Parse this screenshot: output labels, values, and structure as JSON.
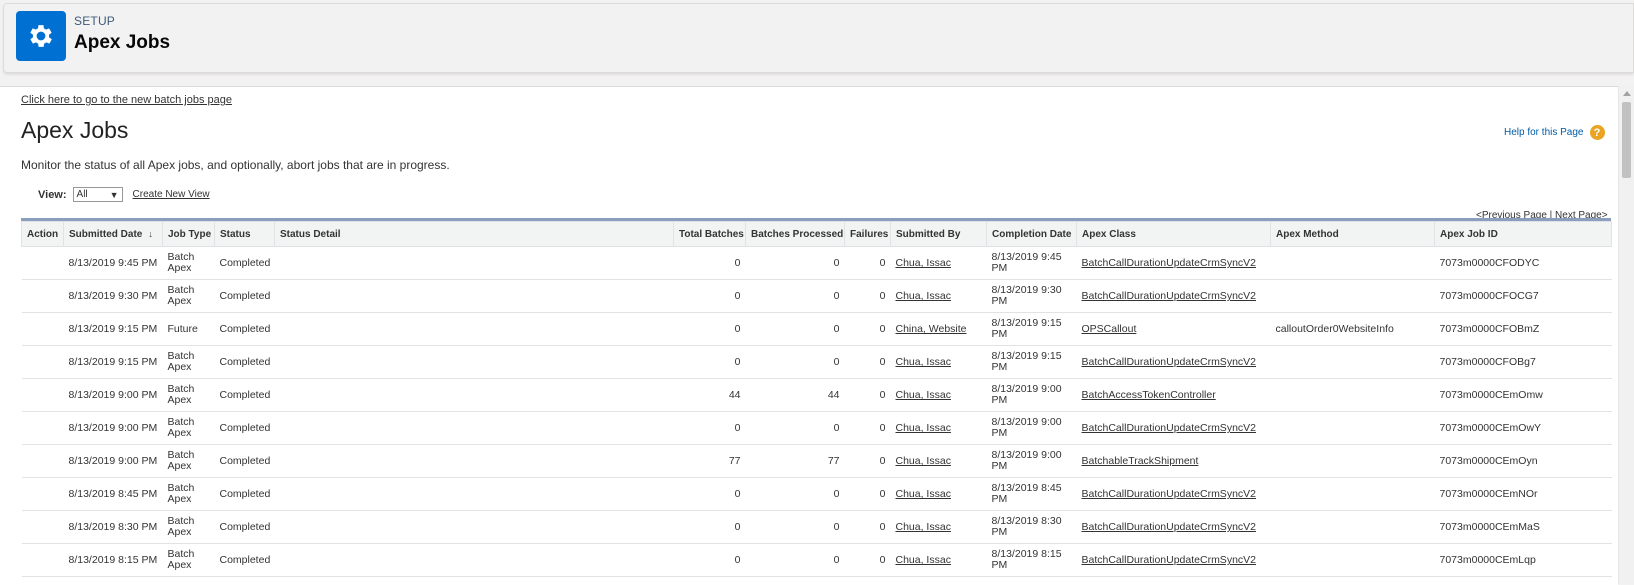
{
  "header": {
    "eyebrow": "SETUP",
    "title": "Apex Jobs",
    "icon": "gear-icon",
    "icon_color": "#0070d2"
  },
  "top_link": "Click here to go to the new batch jobs page",
  "page_title": "Apex Jobs",
  "help": {
    "label": "Help for this Page",
    "icon": "?"
  },
  "description": "Monitor the status of all Apex jobs, and optionally, abort jobs that are in progress.",
  "view": {
    "label": "View:",
    "selected": "All",
    "create_link": "Create New View"
  },
  "pager": {
    "prev": "<Previous Page",
    "sep": " | ",
    "next": "Next Page>"
  },
  "columns": [
    "Action",
    "Submitted Date",
    "Job Type",
    "Status",
    "Status Detail",
    "Total Batches",
    "Batches Processed",
    "Failures",
    "Submitted By",
    "Completion Date",
    "Apex Class",
    "Apex Method",
    "Apex Job ID"
  ],
  "rows": [
    {
      "action": "",
      "submitted": "8/13/2019 9:45 PM",
      "type": "Batch Apex",
      "status": "Completed",
      "detail": "",
      "total": "0",
      "processed": "0",
      "failures": "0",
      "by": "Chua, Issac",
      "completion": "8/13/2019 9:45 PM",
      "class": "BatchCallDurationUpdateCrmSyncV2",
      "method": "",
      "id": "7073m0000CFODYC"
    },
    {
      "action": "",
      "submitted": "8/13/2019 9:30 PM",
      "type": "Batch Apex",
      "status": "Completed",
      "detail": "",
      "total": "0",
      "processed": "0",
      "failures": "0",
      "by": "Chua, Issac",
      "completion": "8/13/2019 9:30 PM",
      "class": "BatchCallDurationUpdateCrmSyncV2",
      "method": "",
      "id": "7073m0000CFOCG7"
    },
    {
      "action": "",
      "submitted": "8/13/2019 9:15 PM",
      "type": "Future",
      "status": "Completed",
      "detail": "",
      "total": "0",
      "processed": "0",
      "failures": "0",
      "by": "China, Website",
      "completion": "8/13/2019 9:15 PM",
      "class": "OPSCallout",
      "method": "calloutOrder0WebsiteInfo",
      "id": "7073m0000CFOBmZ"
    },
    {
      "action": "",
      "submitted": "8/13/2019 9:15 PM",
      "type": "Batch Apex",
      "status": "Completed",
      "detail": "",
      "total": "0",
      "processed": "0",
      "failures": "0",
      "by": "Chua, Issac",
      "completion": "8/13/2019 9:15 PM",
      "class": "BatchCallDurationUpdateCrmSyncV2",
      "method": "",
      "id": "7073m0000CFOBg7"
    },
    {
      "action": "",
      "submitted": "8/13/2019 9:00 PM",
      "type": "Batch Apex",
      "status": "Completed",
      "detail": "",
      "total": "44",
      "processed": "44",
      "failures": "0",
      "by": "Chua, Issac",
      "completion": "8/13/2019 9:00 PM",
      "class": "BatchAccessTokenController",
      "method": "",
      "id": "7073m0000CEmOmw"
    },
    {
      "action": "",
      "submitted": "8/13/2019 9:00 PM",
      "type": "Batch Apex",
      "status": "Completed",
      "detail": "",
      "total": "0",
      "processed": "0",
      "failures": "0",
      "by": "Chua, Issac",
      "completion": "8/13/2019 9:00 PM",
      "class": "BatchCallDurationUpdateCrmSyncV2",
      "method": "",
      "id": "7073m0000CEmOwY"
    },
    {
      "action": "",
      "submitted": "8/13/2019 9:00 PM",
      "type": "Batch Apex",
      "status": "Completed",
      "detail": "",
      "total": "77",
      "processed": "77",
      "failures": "0",
      "by": "Chua, Issac",
      "completion": "8/13/2019 9:00 PM",
      "class": "BatchableTrackShipment",
      "method": "",
      "id": "7073m0000CEmOyn"
    },
    {
      "action": "",
      "submitted": "8/13/2019 8:45 PM",
      "type": "Batch Apex",
      "status": "Completed",
      "detail": "",
      "total": "0",
      "processed": "0",
      "failures": "0",
      "by": "Chua, Issac",
      "completion": "8/13/2019 8:45 PM",
      "class": "BatchCallDurationUpdateCrmSyncV2",
      "method": "",
      "id": "7073m0000CEmNOr"
    },
    {
      "action": "",
      "submitted": "8/13/2019 8:30 PM",
      "type": "Batch Apex",
      "status": "Completed",
      "detail": "",
      "total": "0",
      "processed": "0",
      "failures": "0",
      "by": "Chua, Issac",
      "completion": "8/13/2019 8:30 PM",
      "class": "BatchCallDurationUpdateCrmSyncV2",
      "method": "",
      "id": "7073m0000CEmMaS"
    },
    {
      "action": "",
      "submitted": "8/13/2019 8:15 PM",
      "type": "Batch Apex",
      "status": "Completed",
      "detail": "",
      "total": "0",
      "processed": "0",
      "failures": "0",
      "by": "Chua, Issac",
      "completion": "8/13/2019 8:15 PM",
      "class": "BatchCallDurationUpdateCrmSyncV2",
      "method": "",
      "id": "7073m0000CEmLqp"
    }
  ]
}
